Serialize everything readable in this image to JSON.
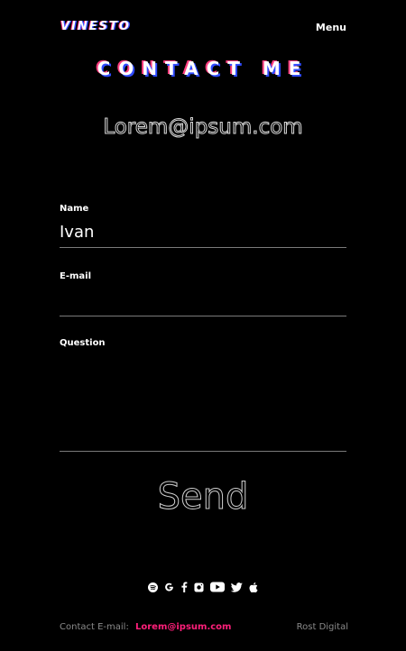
{
  "header": {
    "logo": "VINESTO",
    "menu_label": "Menu"
  },
  "hero": {
    "title": "CONTACT ME",
    "email": "Lorem@ipsum.com"
  },
  "form": {
    "name_label": "Name",
    "name_value": "Ivan",
    "email_label": "E-mail",
    "email_value": "",
    "question_label": "Question",
    "question_value": "",
    "send_label": "Send"
  },
  "socials": [
    {
      "icon": "spotify-icon"
    },
    {
      "icon": "google-icon"
    },
    {
      "icon": "facebook-icon"
    },
    {
      "icon": "instagram-icon"
    },
    {
      "icon": "youtube-icon"
    },
    {
      "icon": "twitter-icon"
    },
    {
      "icon": "apple-icon"
    }
  ],
  "footer": {
    "contact_prefix": "Contact E-mail:",
    "contact_email": "Lorem@ipsum.com",
    "credit": "Rost Digital"
  },
  "colors": {
    "background": "#000000",
    "accent_pink": "#ff1f7a",
    "accent_blue": "#2f4bff"
  }
}
